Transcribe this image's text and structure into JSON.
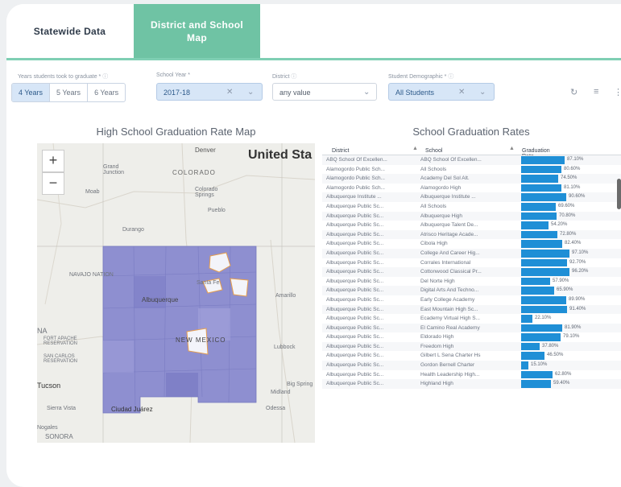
{
  "tabs": [
    {
      "label": "Statewide Data"
    },
    {
      "label": "District and School Map"
    }
  ],
  "filters": {
    "years": {
      "label": "Years students took to graduate *",
      "options": [
        "4 Years",
        "5 Years",
        "6 Years"
      ],
      "selected": "4 Years"
    },
    "school_year": {
      "label": "School Year *",
      "value": "2017-18"
    },
    "district": {
      "label": "District",
      "value": "any value"
    },
    "demographic": {
      "label": "Student Demographic *",
      "value": "All Students"
    }
  },
  "map": {
    "title": "High School Graduation Rate Map",
    "labels": {
      "denver": "Denver",
      "united_states": "United Sta",
      "colorado": "COLORADO",
      "grand_junction": "Grand Junction",
      "moab": "Moab",
      "colorado_springs": "Colorado Springs",
      "pueblo": "Pueblo",
      "durango": "Durango",
      "navajo": "NAVAJO NATION",
      "santa_fe": "Santa Fe",
      "albuquerque": "Albuquerque",
      "amarillo": "Amarillo",
      "new_mexico": "NEW MEXICO",
      "lubbock": "Lubbock",
      "fort_apache": "FORT APACHE RESERVATION",
      "san_carlos": "SAN CARLOS RESERVATION",
      "tucson": "Tucson",
      "sierra_vista": "Sierra Vista",
      "nogales": "Nogales",
      "ciudad_juarez": "Ciudad Juárez",
      "midland": "Midland",
      "odessa": "Odessa",
      "big_spring": "Big Spring",
      "sonora": "SONORA",
      "na": "NA"
    }
  },
  "table": {
    "title": "School Graduation Rates",
    "headers": {
      "district": "District",
      "school": "School",
      "rate": "Graduation Rate"
    },
    "rows": [
      {
        "district": "ABQ School Of Excellen...",
        "school": "ABQ School Of Excellen...",
        "rate": 87.1,
        "label": "87.10%"
      },
      {
        "district": "Alamogordo Public Sch...",
        "school": "All Schools",
        "rate": 80.6,
        "label": "80.60%"
      },
      {
        "district": "Alamogordo Public Sch...",
        "school": "Academy Del Sol Alt.",
        "rate": 74.5,
        "label": "74.50%"
      },
      {
        "district": "Alamogordo Public Sch...",
        "school": "Alamogordo High",
        "rate": 81.1,
        "label": "81.10%"
      },
      {
        "district": "Albuquerque Institute ...",
        "school": "Albuquerque Institute ...",
        "rate": 90.6,
        "label": "90.60%"
      },
      {
        "district": "Albuquerque Public Sc...",
        "school": "All Schools",
        "rate": 69.6,
        "label": "69.60%"
      },
      {
        "district": "Albuquerque Public Sc...",
        "school": "Albuquerque High",
        "rate": 70.8,
        "label": "70.80%"
      },
      {
        "district": "Albuquerque Public Sc...",
        "school": "Albuquerque Talent De...",
        "rate": 54.2,
        "label": "54.20%"
      },
      {
        "district": "Albuquerque Public Sc...",
        "school": "Atrisco Heritage Acade...",
        "rate": 72.8,
        "label": "72.80%"
      },
      {
        "district": "Albuquerque Public Sc...",
        "school": "Cibola High",
        "rate": 82.4,
        "label": "82.40%"
      },
      {
        "district": "Albuquerque Public Sc...",
        "school": "College And Career Hig...",
        "rate": 97.1,
        "label": "97.10%"
      },
      {
        "district": "Albuquerque Public Sc...",
        "school": "Corrales International",
        "rate": 92.7,
        "label": "92.70%"
      },
      {
        "district": "Albuquerque Public Sc...",
        "school": "Cottonwood Classical Pr...",
        "rate": 96.2,
        "label": "96.20%"
      },
      {
        "district": "Albuquerque Public Sc...",
        "school": "Del Norte High",
        "rate": 57.9,
        "label": "57.90%"
      },
      {
        "district": "Albuquerque Public Sc...",
        "school": "Digital Arts And Techno...",
        "rate": 65.9,
        "label": "65.90%"
      },
      {
        "district": "Albuquerque Public Sc...",
        "school": "Early College Academy",
        "rate": 89.9,
        "label": "89.90%"
      },
      {
        "district": "Albuquerque Public Sc...",
        "school": "East Mountain High Sc...",
        "rate": 91.4,
        "label": "91.40%"
      },
      {
        "district": "Albuquerque Public Sc...",
        "school": "Ecademy Virtual High S...",
        "rate": 22.1,
        "label": "22.10%"
      },
      {
        "district": "Albuquerque Public Sc...",
        "school": "El Camino Real Academy",
        "rate": 81.9,
        "label": "81.90%"
      },
      {
        "district": "Albuquerque Public Sc...",
        "school": "Eldorado High",
        "rate": 79.1,
        "label": "79.10%"
      },
      {
        "district": "Albuquerque Public Sc...",
        "school": "Freedom High",
        "rate": 37.8,
        "label": "37.80%"
      },
      {
        "district": "Albuquerque Public Sc...",
        "school": "Gilbert L Sena Charter Hs",
        "rate": 46.5,
        "label": "46.50%"
      },
      {
        "district": "Albuquerque Public Sc...",
        "school": "Gordon Bernell Charter",
        "rate": 15.1,
        "label": "15.10%"
      },
      {
        "district": "Albuquerque Public Sc...",
        "school": "Health Leadership High...",
        "rate": 62.8,
        "label": "62.80%"
      },
      {
        "district": "Albuquerque Public Sc...",
        "school": "Highland High",
        "rate": 59.4,
        "label": "59.40%"
      }
    ]
  },
  "colors": {
    "tab_active": "#6fc3a4",
    "bar": "#1f8fd6",
    "map_fill": "#8e8fd0",
    "highlight_border": "#f0a040"
  }
}
